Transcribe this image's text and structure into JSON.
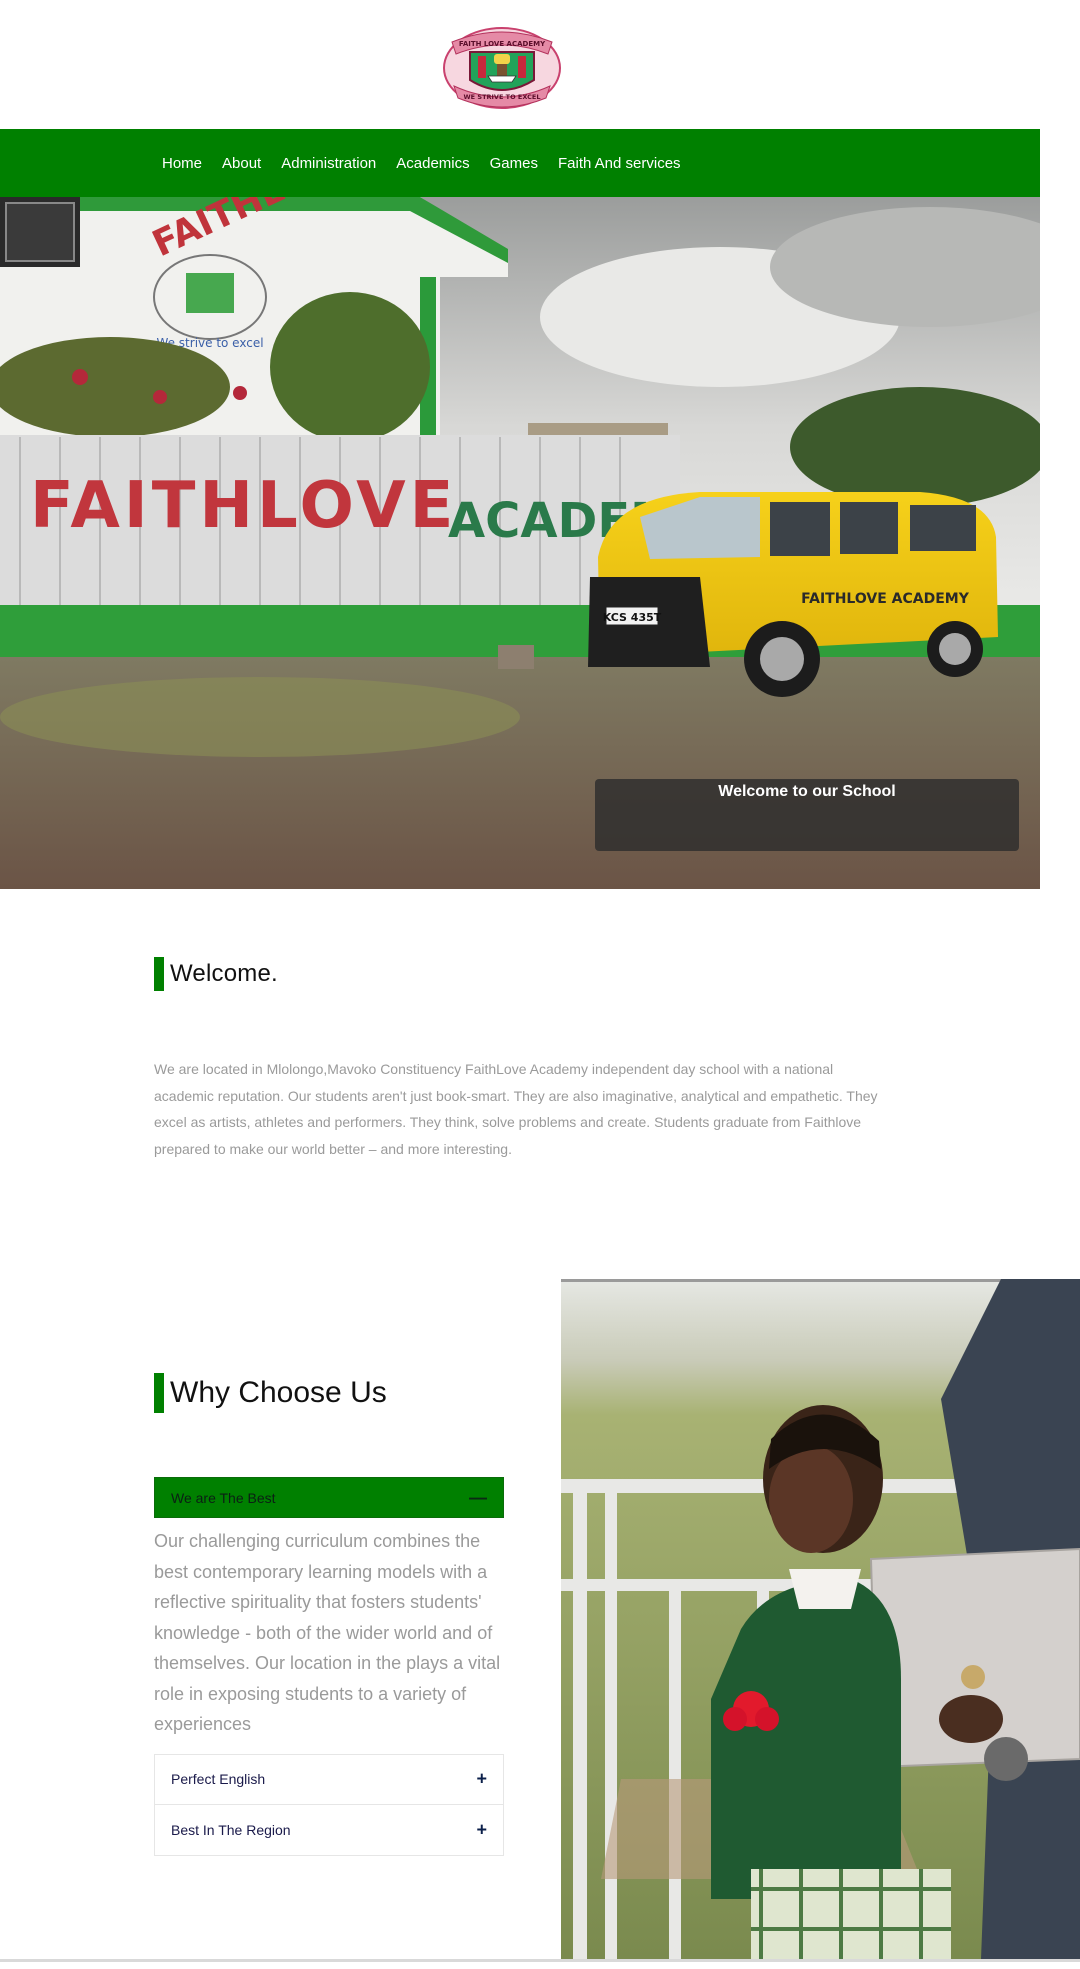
{
  "logo": {
    "top_text": "FAITH LOVE ACADEMY",
    "bottom_text": "WE STRIVE TO EXCEL"
  },
  "nav": {
    "items": [
      "Home",
      "About",
      "Administration",
      "Academics",
      "Games",
      "Faith And services"
    ]
  },
  "hero": {
    "caption": "Welcome to our School",
    "wall_text_left": "FAITHLOVE",
    "wall_text_right": "ACADEMY",
    "building_text": "FAITHLOVE ACADEMY",
    "van_text": "FAITHLOVE ACADEMY",
    "plate": "KCS 435T",
    "mural_motto": "We strive to excel"
  },
  "welcome": {
    "title": "Welcome.",
    "text": "We are located in Mlolongo,Mavoko Constituency FaithLove Academy independent day school with a national academic reputation. Our students aren't just book-smart. They are also imaginative, analytical and empathetic. They excel as artists, athletes and performers. They think, solve problems and create. Students graduate from Faithlove prepared to make our world better – and more interesting."
  },
  "why": {
    "title": "Why Choose Us",
    "accordion": [
      {
        "label": "We are The Best",
        "icon": "minus-icon",
        "expanded": true,
        "body": "Our challenging curriculum combines the best contemporary learning models with a reflective spirituality that fosters students' knowledge - both of the wider world and of themselves. Our location in the  plays a vital role in exposing students to a variety of experiences"
      },
      {
        "label": "Perfect English",
        "icon": "plus-icon",
        "expanded": false
      },
      {
        "label": "Best In The Region",
        "icon": "plus-icon",
        "expanded": false
      }
    ]
  },
  "colors": {
    "brand_green": "#008000",
    "caption_bg": "#2d2d2d",
    "body_text": "#9a9a9a"
  }
}
